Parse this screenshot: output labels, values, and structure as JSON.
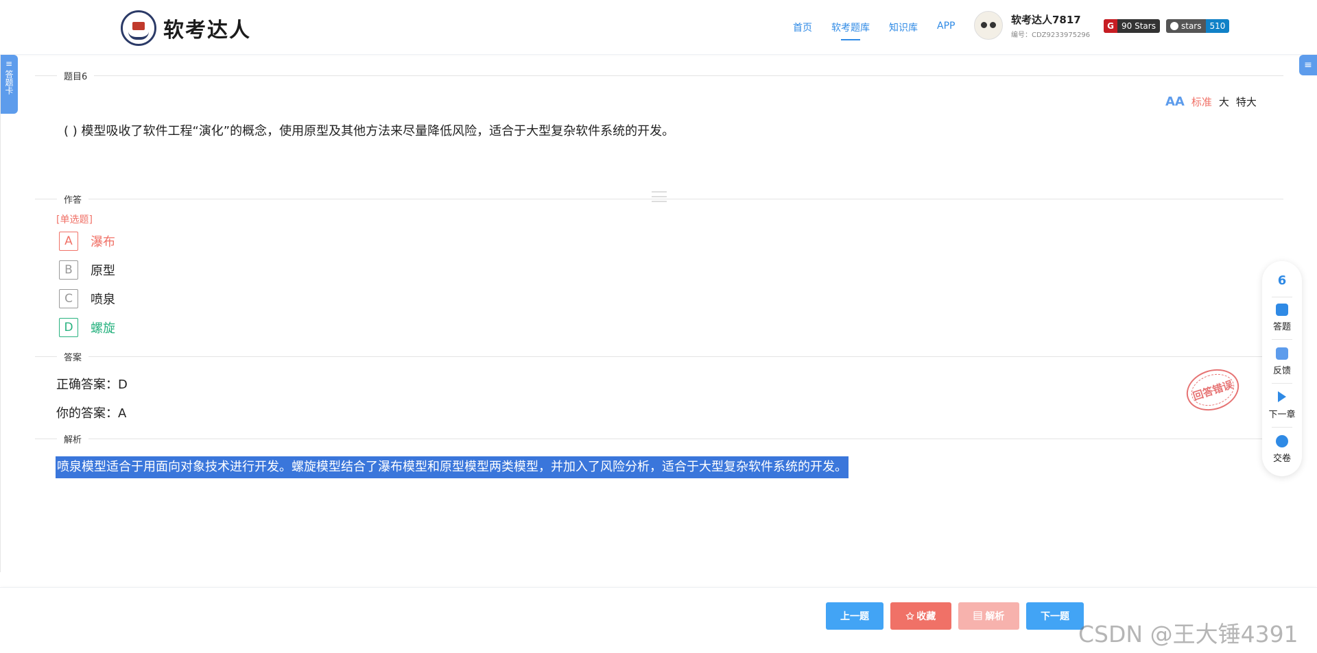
{
  "header": {
    "logo_text": "软考达人",
    "nav": [
      {
        "label": "首页",
        "active": false
      },
      {
        "label": "软考题库",
        "active": true
      },
      {
        "label": "知识库",
        "active": false
      },
      {
        "label": "APP",
        "active": false
      }
    ],
    "user_name": "软考达人7817",
    "user_id": "编号：CDZ9233975296",
    "gitee_badge": {
      "icon": "G",
      "text": "90 Stars"
    },
    "github_badge": {
      "label": "stars",
      "count": "510"
    }
  },
  "left_tab": {
    "label": "答题卡",
    "icon": "menu-icon"
  },
  "right_tab": {
    "icon": "menu-icon"
  },
  "question": {
    "section_title": "题目6",
    "text": "( ) 模型吸收了软件工程“演化”的概念，使用原型及其他方法来尽量降低风险，适合于大型复杂软件系统的开发。",
    "font_sizes": {
      "icon": "AA",
      "standard": "标准",
      "large": "大",
      "xlarge": "特大",
      "selected": "standard"
    }
  },
  "answer_section": {
    "title": "作答",
    "type": "[单选题]",
    "options": [
      {
        "key": "A",
        "text": "瀑布",
        "state": "wrong"
      },
      {
        "key": "B",
        "text": "原型",
        "state": "normal"
      },
      {
        "key": "C",
        "text": "喷泉",
        "state": "normal"
      },
      {
        "key": "D",
        "text": "螺旋",
        "state": "right"
      }
    ]
  },
  "result_section": {
    "title": "答案",
    "correct": "正确答案：D",
    "yours": "你的答案：A",
    "stamp": "回答错误"
  },
  "analysis_section": {
    "title": "解析",
    "text": "喷泉模型适合于用面向对象技术进行开发。螺旋模型结合了瀑布模型和原型模型两类模型，并加入了风险分析，适合于大型复杂软件系统的开发。"
  },
  "float_panel": {
    "number": "6",
    "items": [
      {
        "label": "答题",
        "icon": "answer-icon"
      },
      {
        "label": "反馈",
        "icon": "feedback-icon"
      },
      {
        "label": "下一章",
        "icon": "next-chapter-icon"
      },
      {
        "label": "交卷",
        "icon": "submit-icon"
      }
    ]
  },
  "bottom_bar": {
    "prev": "上一题",
    "favorite": "✩ 收藏",
    "analysis": "▤ 解析",
    "next": "下一题"
  },
  "watermark": "CSDN @王大锤4391",
  "colors": {
    "primary": "#2f8ae5",
    "wrong": "#f07167",
    "right": "#27b27f",
    "highlight": "#3a76db"
  }
}
